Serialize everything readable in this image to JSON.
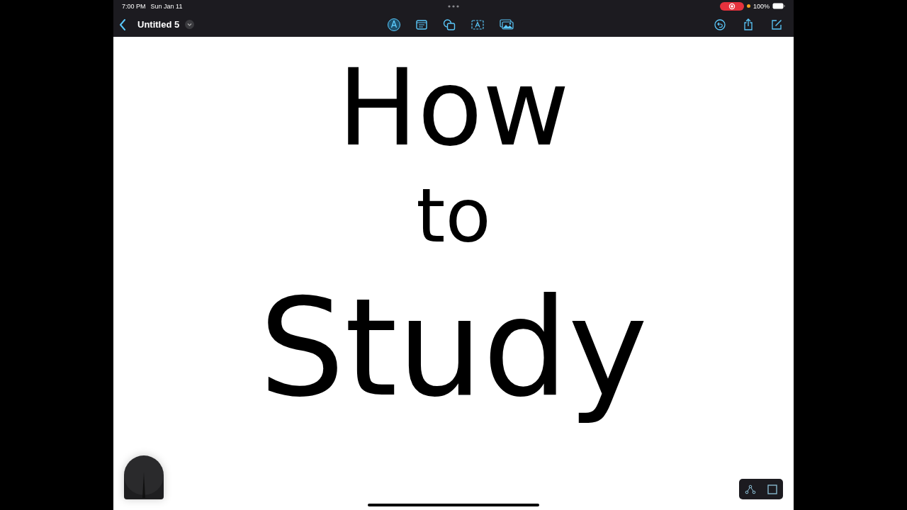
{
  "status_bar": {
    "time": "7:00 PM",
    "date": "Sun Jan 11",
    "battery": "100%"
  },
  "toolbar": {
    "title": "Untitled 5"
  },
  "canvas": {
    "handwriting": [
      "How",
      "to",
      "Study"
    ]
  }
}
